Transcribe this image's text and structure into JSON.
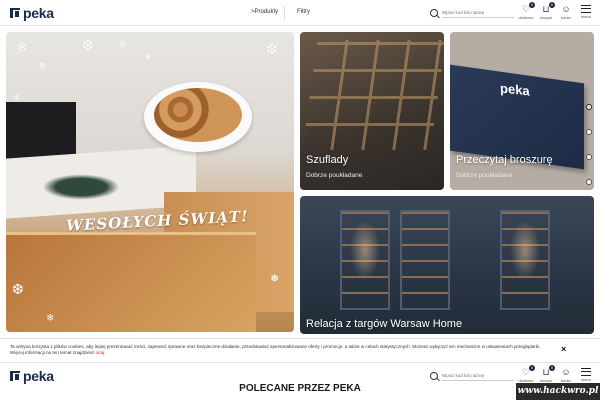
{
  "header": {
    "logo_text": "peka",
    "nav_products": ">Produkty",
    "nav_filters": "Filtry",
    "search_placeholder": "Wpisz kod lub nazwę",
    "favorites_label": "ulubione",
    "favorites_count": "0",
    "cart_label": "koszyk",
    "cart_count": "0",
    "account_label": "konto",
    "menu_label": "menu"
  },
  "hero": {
    "title": "WESOŁYCH ŚWIĄT!"
  },
  "tiles": [
    {
      "title": "Szuflady",
      "subtitle": "Dobrze poukładane"
    },
    {
      "title": "Przeczytaj broszurę",
      "subtitle": "Dobrze poukładane"
    },
    {
      "title": "Relacja z targów Warsaw Home",
      "subtitle": ""
    }
  ],
  "brochure_logo": "peka",
  "cookie": {
    "text": "Ta witryna korzysta z plików cookies, aby lepiej prezentować treści, zapewnić sprawne oraz bezpieczne działanie, przedstawiać spersonalizowane oferty i promocje, a także w celach statystycznych. Możesz wyłączyć ten mechanizm w ustawieniach przeglądarki. Więcej informacji na ten temat znajdziesz ",
    "link": "tutaj",
    "close": "×"
  },
  "recommended_title": "POLECANE PRZEZ PEKA",
  "watermark": "www.hackwro.pl",
  "colors": {
    "brand": "#1a2a4a",
    "cookie_link": "#c0392b"
  }
}
